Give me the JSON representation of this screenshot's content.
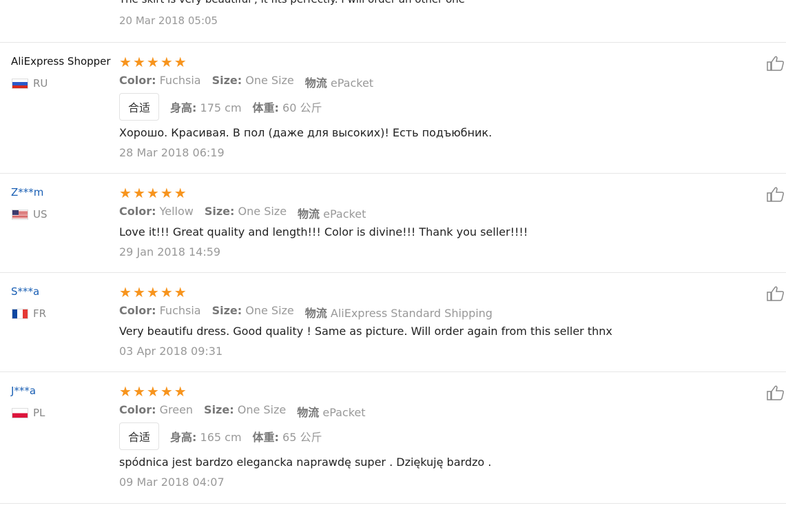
{
  "partial": {
    "text": "The skirt is very beautiful , it fits perfectly. I will order an other one",
    "date": "20 Mar 2018 05:05"
  },
  "labels": {
    "color": "Color:",
    "size": "Size:",
    "shipping": "物流",
    "fit": "合适",
    "height": "身高:",
    "weight": "体重:"
  },
  "reviews": [
    {
      "user": "AliExpress Shopper",
      "country": "RU",
      "color": "Fuchsia",
      "size": "One Size",
      "shipping": "ePacket",
      "height": "175 cm",
      "weight": "60 公斤",
      "text": "Хорошо. Красивая. В пол (даже для высоких)! Есть подъюбник.",
      "date": "28 Mar 2018 06:19",
      "rating": 5
    },
    {
      "user": "Z***m",
      "country": "US",
      "color": "Yellow",
      "size": "One Size",
      "shipping": "ePacket",
      "text": "Love it!!! Great quality and length!!! Color is divine!!! Thank you seller!!!!",
      "date": "29 Jan 2018 14:59",
      "rating": 5
    },
    {
      "user": "S***a",
      "country": "FR",
      "color": "Fuchsia",
      "size": "One Size",
      "shipping": "AliExpress Standard Shipping",
      "text": "Very beautifu dress. Good quality ! Same as picture. Will order again from this seller thnx",
      "date": "03 Apr 2018 09:31",
      "rating": 5
    },
    {
      "user": "J***a",
      "country": "PL",
      "color": "Green",
      "size": "One Size",
      "shipping": "ePacket",
      "height": "165 cm",
      "weight": "65 公斤",
      "text": "spódnica jest bardzo elegancka naprawdę super . Dziękuję bardzo .",
      "date": "09 Mar 2018 04:07",
      "rating": 5
    }
  ],
  "colors": {
    "star": "#f7941d",
    "anon_user": "#1a5fb4",
    "muted": "#999999",
    "divider": "#e6e6e6"
  },
  "icons": {
    "rating": "star-icon",
    "like": "thumbs-up-icon"
  }
}
